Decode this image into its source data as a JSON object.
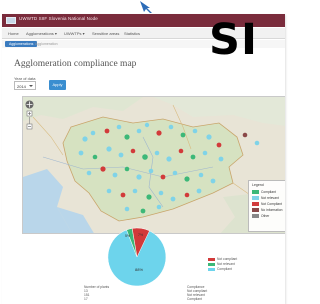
{
  "header": {
    "title": "UWWTD SIIF Slovenia National Node"
  },
  "nav": {
    "items": [
      "Home",
      "Agglomerations ▾",
      "UWWTPs ▾",
      "Sensitive areas",
      "Statistics"
    ]
  },
  "breadcrumb": {
    "active": "Agglomerations",
    "next": "Agglomeration"
  },
  "country_code": "SI",
  "page": {
    "title": "Agglomeration compliance map"
  },
  "filter": {
    "year_label": "Year of data",
    "year_value": "2014",
    "apply_label": "Apply"
  },
  "map": {
    "legend_title": "Legend",
    "legend_items": [
      {
        "label": "Compliant",
        "color": "#3cb878"
      },
      {
        "label": "Not relevant",
        "color": "#7fd3e8"
      },
      {
        "label": "Not Compliant",
        "color": "#d23a3a"
      },
      {
        "label": "No information",
        "color": "#8a4848"
      },
      {
        "label": "Other",
        "color": "#888888"
      }
    ],
    "icons": [
      "zoom-in-icon",
      "zoom-out-icon",
      "pan-icon"
    ]
  },
  "pie": {
    "labels": {
      "not_compliant": "7%",
      "not_relevant": "5%",
      "compliant": "88%"
    },
    "colors": {
      "not_compliant": "#d23a3a",
      "not_relevant": "#3cb878",
      "compliant": "#6dd4ec"
    }
  },
  "pie_legend": [
    {
      "label": "Not compliant",
      "color": "#d23a3a"
    },
    {
      "label": "Not relevant",
      "color": "#3cb878"
    },
    {
      "label": "Compliant",
      "color": "#6dd4ec"
    }
  ],
  "stats": {
    "header": [
      "Number of plants",
      "Compliance"
    ],
    "rows": [
      [
        "13",
        "Not compliant"
      ],
      [
        "151",
        "Not relevant"
      ],
      [
        "17",
        "Compliant"
      ]
    ]
  }
}
